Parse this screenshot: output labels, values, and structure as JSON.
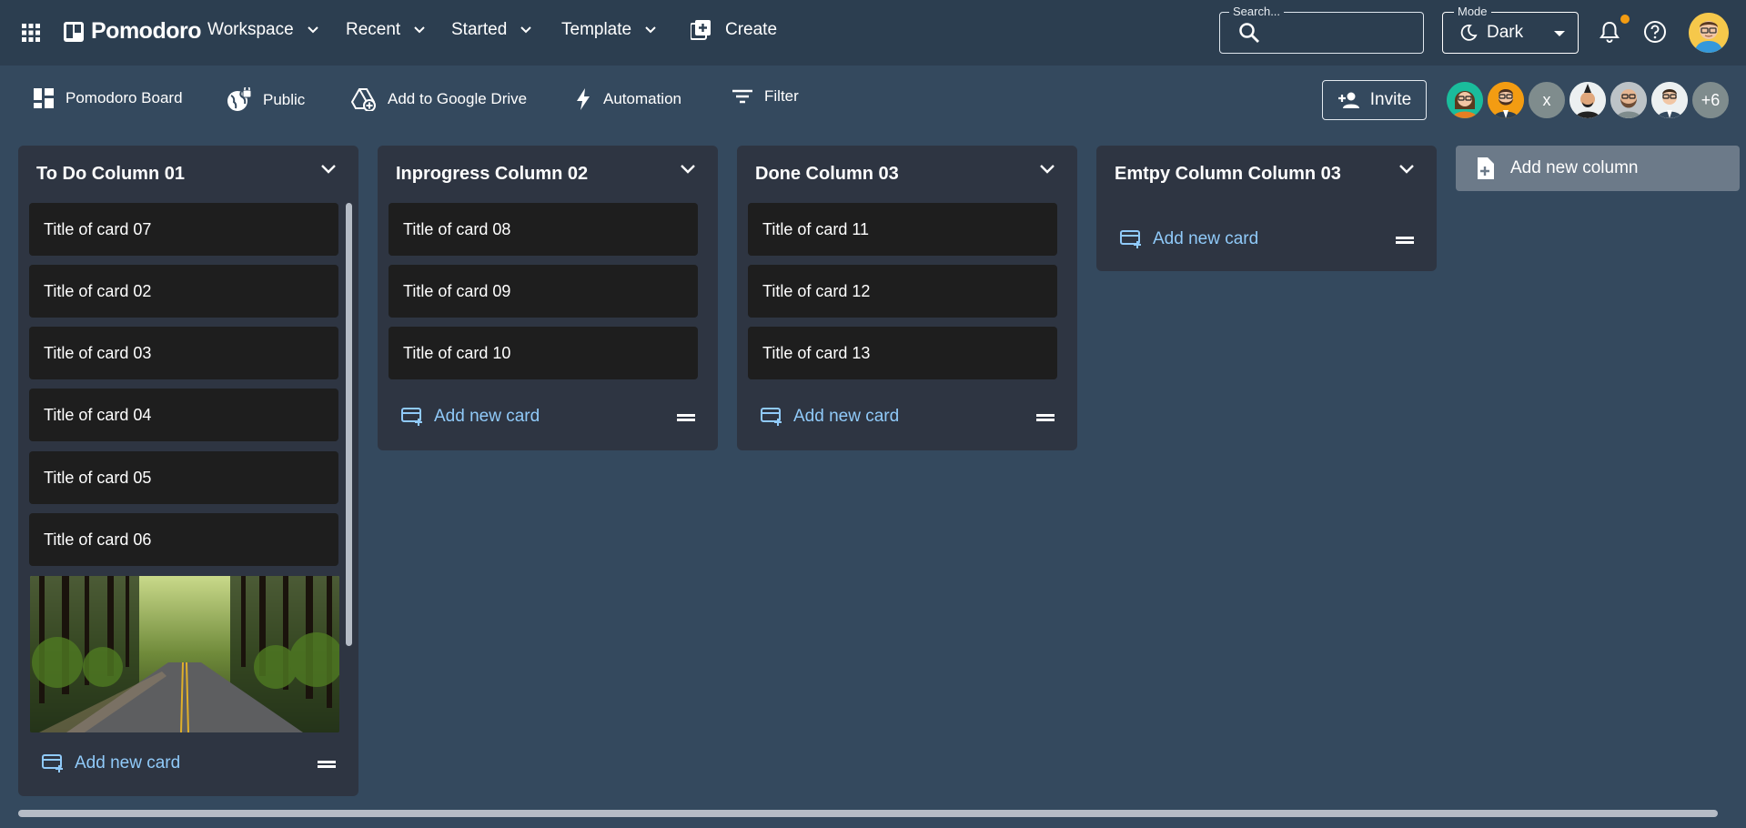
{
  "topbar": {
    "app_name": "Pomodoro",
    "nav": [
      {
        "label": "Workspace"
      },
      {
        "label": "Recent"
      },
      {
        "label": "Started"
      },
      {
        "label": "Template"
      }
    ],
    "create_label": "Create",
    "search": {
      "label": "Search...",
      "value": ""
    },
    "mode": {
      "label": "Mode",
      "value": "Dark"
    },
    "notification_dot_color": "#f39c12"
  },
  "toolbar": {
    "board_label": "Pomodoro Board",
    "visibility_label": "Public",
    "drive_label": "Add to Google Drive",
    "automation_label": "Automation",
    "filter_label": "Filter",
    "invite_label": "Invite",
    "members": [
      {
        "type": "avatar",
        "icon": "woman-glasses-avatar",
        "bg": "#1abc9c"
      },
      {
        "type": "avatar",
        "icon": "man-beard-avatar",
        "bg": "#f39c12"
      },
      {
        "type": "initial",
        "text": "x",
        "bg": "#7f8c8d"
      },
      {
        "type": "avatar",
        "icon": "man-mohawk-avatar",
        "bg": "#ecf0f1"
      },
      {
        "type": "avatar",
        "icon": "man-bald-beard-avatar",
        "bg": "#bdc3c7"
      },
      {
        "type": "avatar",
        "icon": "man-suit-avatar",
        "bg": "#ecf0f1"
      },
      {
        "type": "more",
        "text": "+6",
        "bg": "#7f8c8d"
      }
    ]
  },
  "columns": [
    {
      "title": "To Do Column 01",
      "cards": [
        "Title of card 07",
        "Title of card 02",
        "Title of card 03",
        "Title of card 04",
        "Title of card 05",
        "Title of card 06"
      ],
      "has_image_card": true,
      "add_card_label": "Add new card"
    },
    {
      "title": "Inprogress Column 02",
      "cards": [
        "Title of card 08",
        "Title of card 09",
        "Title of card 10"
      ],
      "add_card_label": "Add new card"
    },
    {
      "title": "Done Column 03",
      "cards": [
        "Title of card 11",
        "Title of card 12",
        "Title of card 13"
      ],
      "add_card_label": "Add new card"
    },
    {
      "title": "Emtpy Column Column 03",
      "cards": [],
      "add_card_label": "Add new card"
    }
  ],
  "add_column_label": "Add new column",
  "colors": {
    "topbar_bg": "#2c3e50",
    "board_bg": "#34495e",
    "column_bg": "#2e3542",
    "card_bg": "#1e1e1e",
    "link": "#90caf9"
  }
}
